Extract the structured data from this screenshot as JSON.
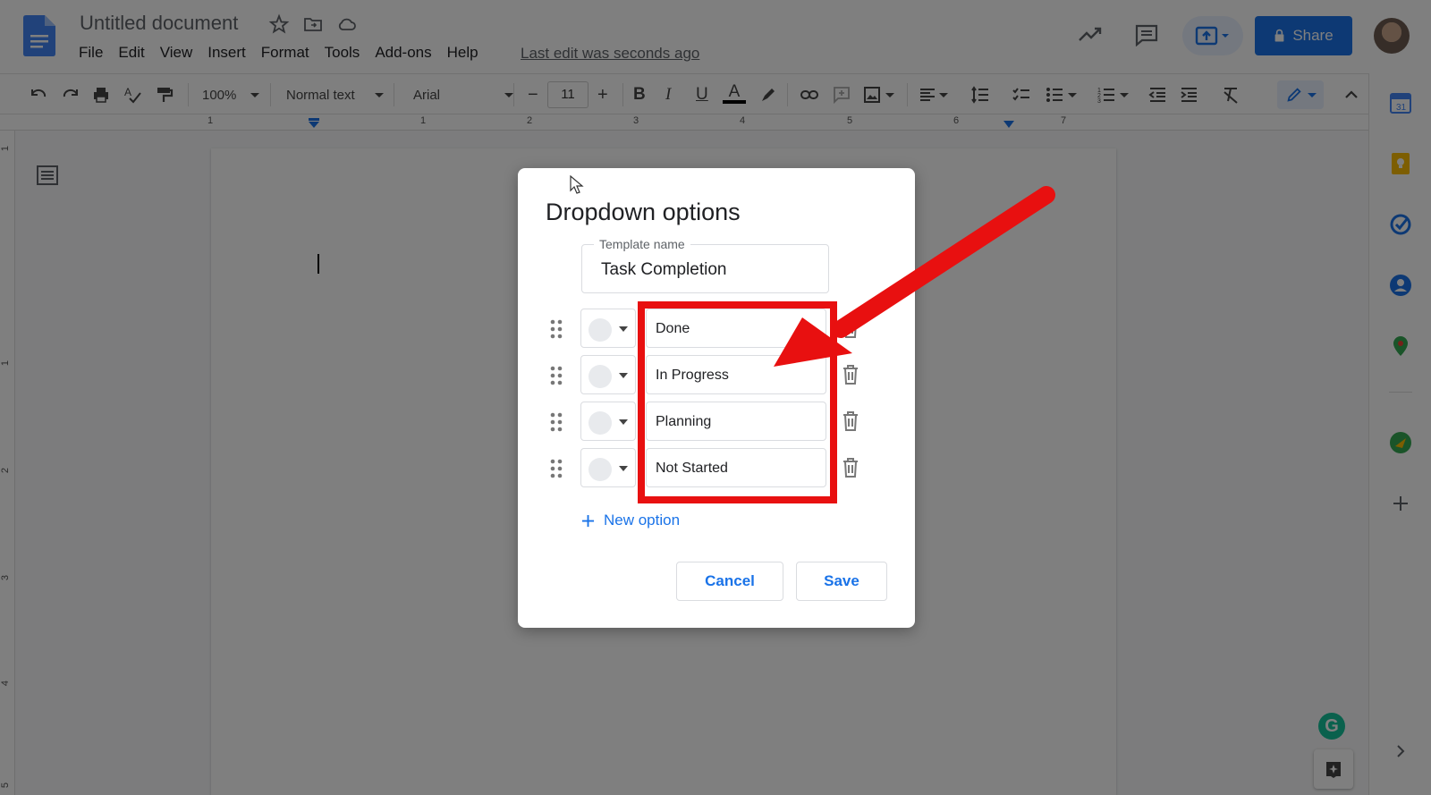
{
  "header": {
    "doc_title": "Untitled document",
    "menu": [
      "File",
      "Edit",
      "View",
      "Insert",
      "Format",
      "Tools",
      "Add-ons",
      "Help"
    ],
    "last_edit": "Last edit was seconds ago",
    "share_label": "Share"
  },
  "toolbar": {
    "zoom": "100%",
    "style": "Normal text",
    "font": "Arial",
    "font_size": "11"
  },
  "ruler": {
    "top_numbers": [
      "1",
      "1",
      "2",
      "3",
      "4",
      "5",
      "6",
      "7"
    ],
    "left_numbers": [
      "1",
      "1",
      "2",
      "3",
      "4",
      "5"
    ]
  },
  "dialog": {
    "title": "Dropdown options",
    "template_label": "Template name",
    "template_value": "Task Completion",
    "options": [
      {
        "label": "Done"
      },
      {
        "label": "In Progress"
      },
      {
        "label": "Planning"
      },
      {
        "label": "Not Started"
      }
    ],
    "new_option": "New option",
    "cancel": "Cancel",
    "save": "Save"
  },
  "colors": {
    "accent": "#1a73e8",
    "highlight": "#e81010",
    "overlay": "rgba(0,0,0,0.5)"
  },
  "side_panel_icons": [
    "calendar-icon",
    "keep-icon",
    "tasks-icon",
    "contacts-icon",
    "maps-icon",
    "extension-icon",
    "add-icon"
  ]
}
